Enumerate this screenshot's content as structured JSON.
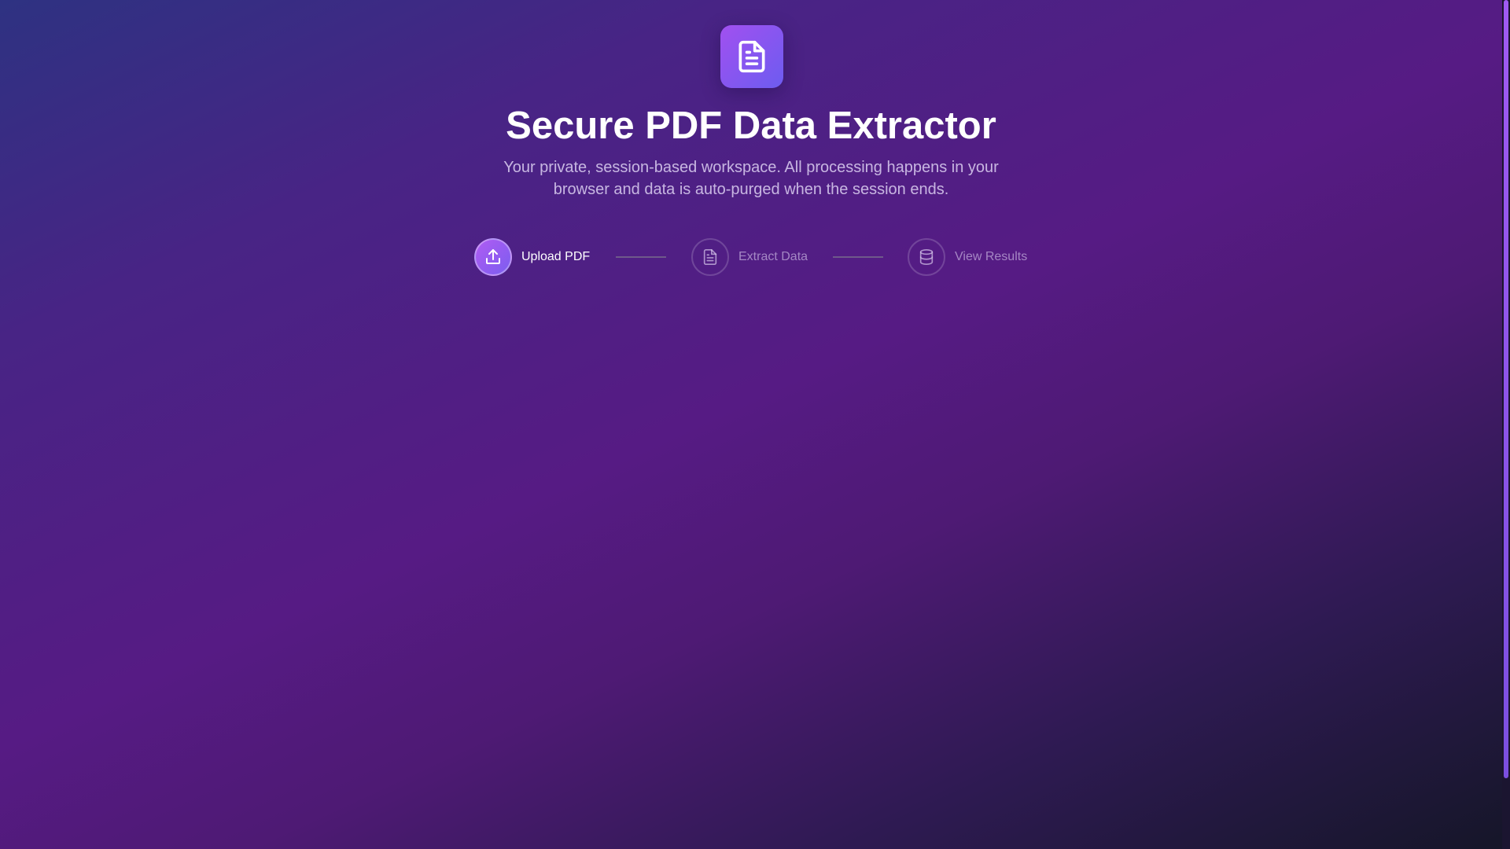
{
  "app": {
    "title": "Secure PDF Data Extractor",
    "subtitle": "Your private, session-based workspace. All processing happens in your browser and data is auto-purged when the session ends.",
    "logo_icon": "document-icon"
  },
  "steps": [
    {
      "label": "Upload PDF",
      "icon": "upload-icon",
      "active": true
    },
    {
      "label": "Extract Data",
      "icon": "file-text-icon",
      "active": false
    },
    {
      "label": "View Results",
      "icon": "database-icon",
      "active": false
    }
  ],
  "colors": {
    "accent": "#a150f0",
    "accent_secondary": "#6d5cf0",
    "background_top": "#2e3282",
    "background_mid": "#561b84",
    "background_bottom": "#151628"
  }
}
